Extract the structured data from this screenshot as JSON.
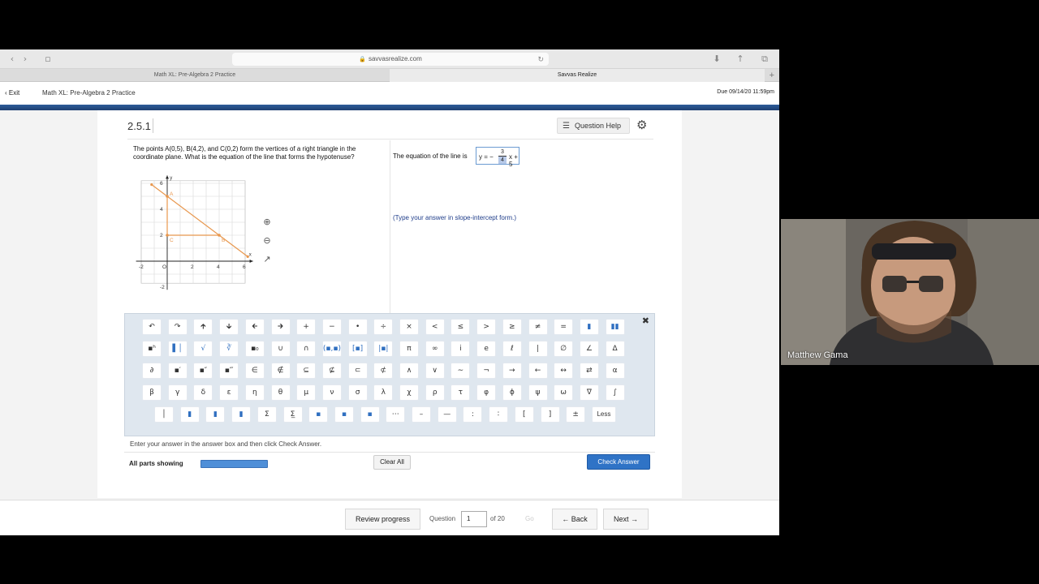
{
  "browser": {
    "url": "savvasrealize.com",
    "tabs": [
      {
        "label": "Math XL: Pre-Algebra 2 Practice",
        "active": false
      },
      {
        "label": "Savvas Realize",
        "active": true
      }
    ]
  },
  "header": {
    "exit_label": "Exit",
    "course_title": "Math XL: Pre-Algebra 2 Practice",
    "due": "Due 09/14/20 11:59pm"
  },
  "question": {
    "number": "2.5.1",
    "help_label": "Question Help",
    "text": "The points A(0,5), B(4,2), and C(0,2) form the vertices of a right triangle in the coordinate plane. What is the equation of the line that forms the hypotenuse?",
    "answer_prefix": "The equation of the line is",
    "answer": {
      "lhs": "y =",
      "sign": "−",
      "numerator": "3",
      "denominator": "4",
      "tail": "x + 5"
    },
    "hint": "(Type your answer in slope-intercept form.)"
  },
  "graph": {
    "x_ticks": [
      "-2",
      "O",
      "2",
      "4",
      "6"
    ],
    "y_ticks": [
      "6",
      "4",
      "2",
      "-2"
    ],
    "x_axis_label": "x",
    "y_axis_label": "y",
    "points": [
      {
        "label": "A",
        "x": 0,
        "y": 5
      },
      {
        "label": "B",
        "x": 4,
        "y": 2
      },
      {
        "label": "C",
        "x": 0,
        "y": 2
      }
    ],
    "accent": "#e8974d"
  },
  "palette": {
    "rows": [
      [
        "↶",
        "↷",
        "🡱",
        "🡳",
        "🡰",
        "🡲",
        "+",
        "−",
        "•",
        "÷",
        "×",
        "<",
        "≤",
        ">",
        "≥",
        "≠",
        "=",
        "▮",
        "▮▮"
      ],
      [
        "▪ʰ",
        "▌│",
        "√",
        "∛",
        "▪₀",
        "∪",
        "∩",
        "(▪,▪)",
        "[▪]",
        "|▪|",
        "π",
        "∞",
        "i",
        "e",
        "ℓ",
        "|",
        "∅",
        "∠",
        "Δ"
      ],
      [
        "∂",
        "▪′",
        "▪″",
        "▪‴",
        "∈",
        "∉",
        "⊆",
        "⊈",
        "⊂",
        "⊄",
        "∧",
        "∨",
        "∼",
        "¬",
        "→",
        "←",
        "↔",
        "⇄",
        "α"
      ],
      [
        "β",
        "γ",
        "δ",
        "ε",
        "η",
        "θ",
        "μ",
        "ν",
        "σ",
        "λ",
        "χ",
        "ρ",
        "τ",
        "φ",
        "ϕ",
        "ψ",
        "ω",
        "∇",
        "∫"
      ],
      [
        "│",
        "▮",
        "▮",
        "▮",
        "Σ",
        "Σ̲",
        "▪",
        "▪",
        "▪",
        "⋯",
        "–",
        "—",
        ":",
        "∶",
        "[",
        "]",
        "±",
        "Less"
      ]
    ]
  },
  "footer_bar": {
    "instruction": "Enter your answer in the answer box and then click Check Answer.",
    "parts_label": "All parts showing",
    "clear_label": "Clear All",
    "check_label": "Check Answer"
  },
  "nav": {
    "review_label": "Review progress",
    "question_label": "Question",
    "question_value": "1",
    "of_label": "of 20",
    "go_label": "Go",
    "back_label": "Back",
    "next_label": "Next"
  },
  "webcam": {
    "name": "Matthew Gama"
  }
}
